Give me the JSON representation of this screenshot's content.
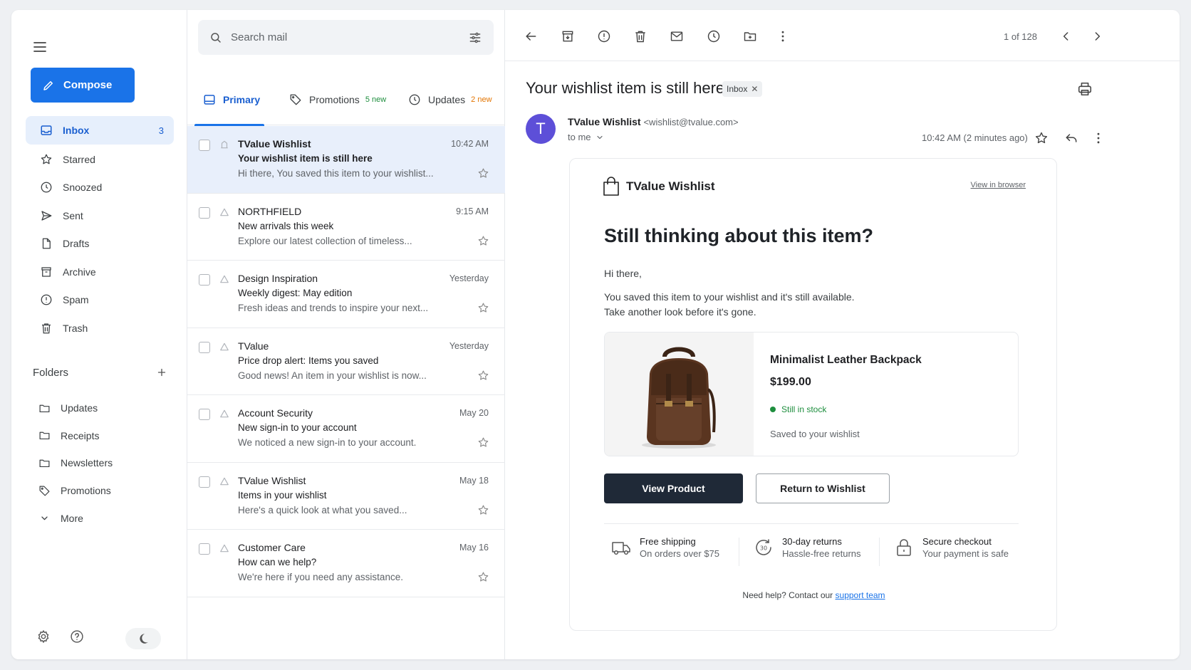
{
  "sidebar": {
    "compose_label": "Compose",
    "nav": [
      {
        "label": "Inbox",
        "count": "3",
        "icon": "inbox-icon"
      },
      {
        "label": "Starred",
        "count": "",
        "icon": "star-icon"
      },
      {
        "label": "Snoozed",
        "count": "",
        "icon": "clock-icon"
      },
      {
        "label": "Sent",
        "count": "",
        "icon": "send-icon"
      },
      {
        "label": "Drafts",
        "count": "",
        "icon": "draft-icon"
      },
      {
        "label": "Archive",
        "count": "",
        "icon": "archive-icon"
      },
      {
        "label": "Spam",
        "count": "",
        "icon": "spam-icon"
      },
      {
        "label": "Trash",
        "count": "",
        "icon": "trash-icon"
      }
    ],
    "folders_heading": "Folders",
    "folders": [
      {
        "label": "Updates",
        "icon": "folder-icon"
      },
      {
        "label": "Receipts",
        "icon": "folder-icon"
      },
      {
        "label": "Newsletters",
        "icon": "folder-icon"
      },
      {
        "label": "Promotions",
        "icon": "tag-icon"
      },
      {
        "label": "More",
        "icon": "chevron-down-icon"
      }
    ]
  },
  "search": {
    "placeholder": "Search mail"
  },
  "tabs": {
    "primary": "Primary",
    "promotions": "Promotions",
    "promotions_new": "5 new",
    "updates": "Updates",
    "updates_new": "2 new"
  },
  "mails": [
    {
      "from": "TValue Wishlist",
      "time": "10:42 AM",
      "subject": "Your wishlist item is still here",
      "snippet": "Hi there, You saved this item to your wishlist..."
    },
    {
      "from": "NORTHFIELD",
      "time": "9:15 AM",
      "subject": "New arrivals this week",
      "snippet": "Explore our latest collection of timeless..."
    },
    {
      "from": "Design Inspiration",
      "time": "Yesterday",
      "subject": "Weekly digest: May edition",
      "snippet": "Fresh ideas and trends to inspire your next..."
    },
    {
      "from": "TValue",
      "time": "Yesterday",
      "subject": "Price drop alert: Items you saved",
      "snippet": "Good news! An item in your wishlist is now..."
    },
    {
      "from": "Account Security",
      "time": "May 20",
      "subject": "New sign-in to your account",
      "snippet": "We noticed a new sign-in to your account."
    },
    {
      "from": "TValue Wishlist",
      "time": "May 18",
      "subject": "Items in your wishlist",
      "snippet": "Here's a quick look at what you saved..."
    },
    {
      "from": "Customer Care",
      "time": "May 16",
      "subject": "How can we help?",
      "snippet": "We're here if you need any assistance."
    }
  ],
  "reader": {
    "pager": "1 of 128",
    "title": "Your wishlist item is still here",
    "label_chip": "Inbox",
    "avatar_letter": "T",
    "sender_name": "TValue Wishlist",
    "sender_email": "<wishlist@tvalue.com>",
    "to": "to me",
    "time": "10:42 AM (2 minutes ago)"
  },
  "email": {
    "brand": "TValue Wishlist",
    "view_in_browser": "View in browser",
    "headline": "Still thinking about this item?",
    "greeting": "Hi there,",
    "body_line1": "You saved this item to your wishlist and it's still available.",
    "body_line2": "Take another look before it's gone.",
    "product_name": "Minimalist Leather Backpack",
    "product_price": "$199.00",
    "stock_status": "Still in stock",
    "saved_note": "Saved to your wishlist",
    "view_product": "View Product",
    "return_wishlist": "Return to Wishlist",
    "features": [
      {
        "title": "Free shipping",
        "sub": "On orders over $75",
        "icon": "truck-icon"
      },
      {
        "title": "30-day returns",
        "sub": "Hassle-free returns",
        "icon": "return-icon"
      },
      {
        "title": "Secure checkout",
        "sub": "Your payment is safe",
        "icon": "lock-icon"
      }
    ],
    "help_text": "Need help? Contact our",
    "help_link": "support team"
  },
  "colors": {
    "accent": "#1a73e8",
    "active_nav_bg": "#e6effc",
    "promotions_badge": "#1e8e3e",
    "updates_badge": "#e37400",
    "avatar": "#5d4fd8",
    "primary_button": "#1f2937",
    "stock_green": "#1e8e3e"
  }
}
